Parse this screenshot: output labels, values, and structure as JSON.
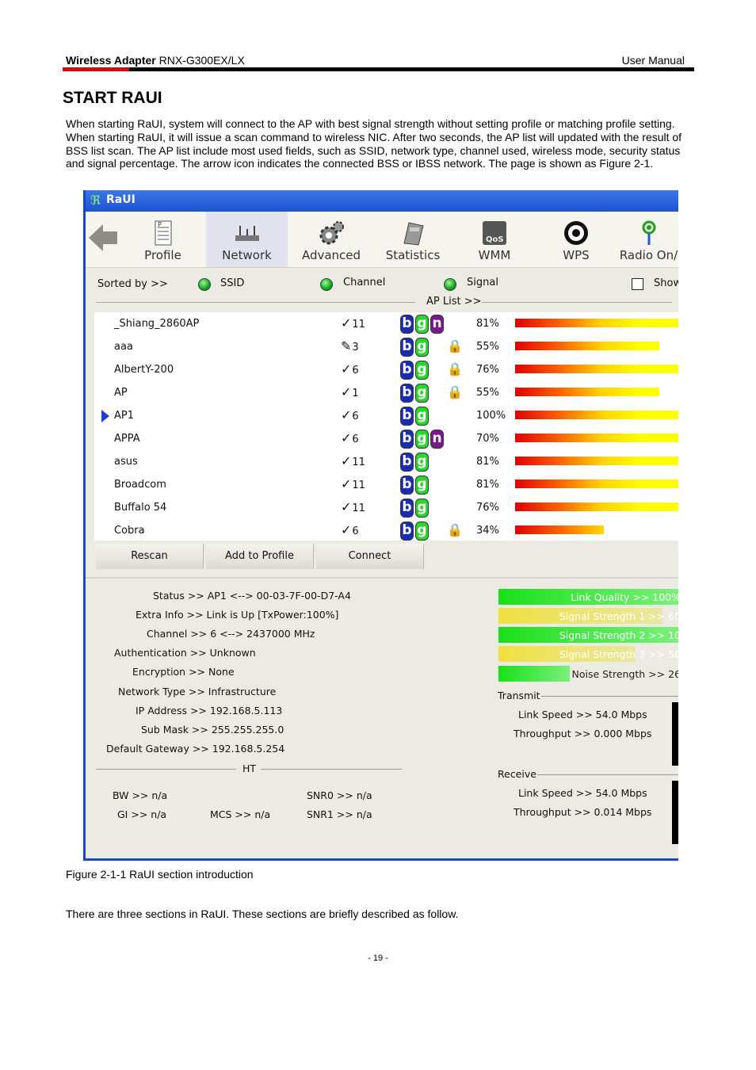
{
  "header": {
    "product_bold": "Wireless Adapter",
    "product_model": "RNX-G300EX/LX",
    "manual": "User Manual"
  },
  "section_title": "START RAUI",
  "intro": "When starting RaUI, system will connect to the AP with best signal strength without setting profile or matching profile setting. When starting RaUI, it will issue a scan command to wireless NIC. After two seconds, the AP list will updated with the result of BSS list scan. The AP list include most used fields, such as SSID, network type, channel used, wireless mode, security status and signal percentage. The arrow icon indicates the connected BSS or IBSS network. The page is shown as Figure 2-1.",
  "window": {
    "title": "RaUI",
    "toolbar": [
      "Profile",
      "Network",
      "Advanced",
      "Statistics",
      "WMM",
      "WPS",
      "Radio On/"
    ],
    "sort": {
      "label": "Sorted by >>",
      "ssid": "SSID",
      "channel": "Channel",
      "signal": "Signal",
      "show": "Show"
    },
    "ap_list_label": "AP List >>",
    "rows": [
      {
        "ssid": "_Shiang_2860AP",
        "channel": "11",
        "n": true,
        "lock": false,
        "signal": 81
      },
      {
        "ssid": "aaa",
        "channel": "3",
        "n": false,
        "lock": true,
        "signal": 55
      },
      {
        "ssid": "AlbertY-200",
        "channel": "6",
        "n": false,
        "lock": true,
        "signal": 76
      },
      {
        "ssid": "AP",
        "channel": "1",
        "n": false,
        "lock": true,
        "signal": 55
      },
      {
        "ssid": "AP1",
        "channel": "6",
        "n": false,
        "lock": false,
        "signal": 100,
        "connected": true
      },
      {
        "ssid": "APPA",
        "channel": "6",
        "n": true,
        "lock": false,
        "signal": 70
      },
      {
        "ssid": "asus",
        "channel": "11",
        "n": false,
        "lock": false,
        "signal": 81
      },
      {
        "ssid": "Broadcom",
        "channel": "11",
        "n": false,
        "lock": false,
        "signal": 81
      },
      {
        "ssid": "Buffalo 54",
        "channel": "11",
        "n": false,
        "lock": false,
        "signal": 76
      },
      {
        "ssid": "Cobra",
        "channel": "6",
        "n": false,
        "lock": true,
        "signal": 34
      }
    ],
    "buttons": [
      "Rescan",
      "Add to Profile",
      "Connect"
    ],
    "status": [
      "Status >> AP1 <--> 00-03-7F-00-D7-A4",
      "Extra Info >> Link is Up [TxPower:100%]",
      "Channel >> 6 <--> 2437000 MHz",
      "Authentication >> Unknown",
      "Encryption >> None",
      "Network Type >> Infrastructure",
      "IP Address >> 192.168.5.113",
      "Sub Mask >> 255.255.255.0",
      "Default Gateway >> 192.168.5.254"
    ],
    "ht_label": "HT",
    "ht": {
      "bw": "BW >> n/a",
      "gi": "GI >> n/a",
      "mcs": "MCS >> n/a",
      "snr0": "SNR0 >> n/a",
      "snr1": "SNR1 >> n/a"
    },
    "quality": [
      {
        "label": "Link Quality >> 100%",
        "fill": 1.0,
        "type": "green"
      },
      {
        "label": "Signal Strength 1 >> 60",
        "fill": 0.9,
        "type": "yellow"
      },
      {
        "label": "Signal Strength 2 >> 10",
        "fill": 1.0,
        "type": "green"
      },
      {
        "label": "Signal Strength 3 >> 50",
        "fill": 0.75,
        "type": "yellow"
      },
      {
        "label": "Noise Strength >> 26",
        "fill": 0.39,
        "type": "green"
      }
    ],
    "transmit": {
      "title": "Transmit",
      "link_speed": "Link Speed >> 54.0 Mbps",
      "throughput": "Throughput >> 0.000 Mbps"
    },
    "receive": {
      "title": "Receive",
      "link_speed": "Link Speed >> 54.0 Mbps",
      "throughput": "Throughput >> 0.014 Mbps"
    }
  },
  "caption": "Figure 2-1-1 RaUI section introduction",
  "para2": "There are three sections in RaUI. These sections are briefly described as follow.",
  "page_number": "- 19 -"
}
